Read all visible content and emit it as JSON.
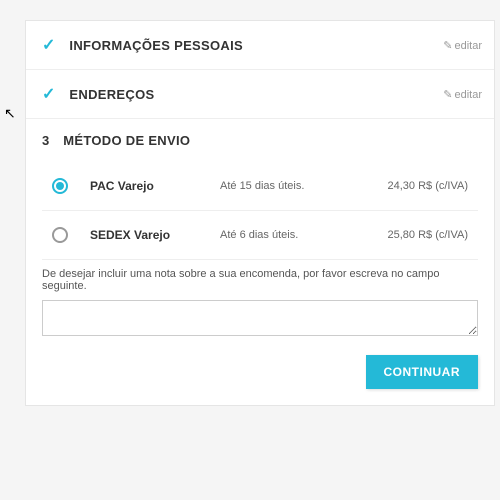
{
  "steps": {
    "personal": {
      "title": "INFORMAÇÕES PESSOAIS",
      "edit": "editar"
    },
    "addresses": {
      "title": "ENDEREÇOS",
      "edit": "editar"
    },
    "shipping": {
      "num": "3",
      "title": "MÉTODO DE ENVIO"
    }
  },
  "shipping_options": [
    {
      "name": "PAC Varejo",
      "delay": "Até 15 dias úteis.",
      "price": "24,30 R$ (c/IVA)",
      "selected": true
    },
    {
      "name": "SEDEX Varejo",
      "delay": "Até 6 dias úteis.",
      "price": "25,80 R$ (c/IVA)",
      "selected": false
    }
  ],
  "note": {
    "label": "De desejar incluir uma nota sobre a sua encomenda, por favor escreva no campo seguinte.",
    "value": ""
  },
  "buttons": {
    "continue": "CONTINUAR"
  }
}
